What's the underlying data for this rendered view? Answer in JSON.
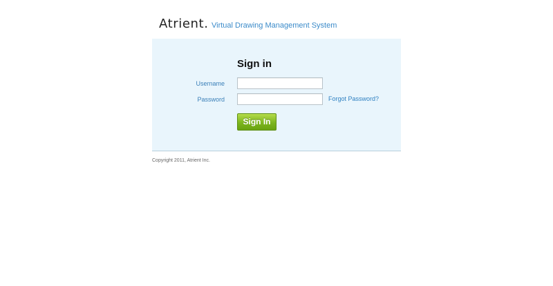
{
  "header": {
    "logo_text": "Atrient.",
    "tagline": "Virtual Drawing Management System"
  },
  "signin": {
    "heading": "Sign in",
    "username_label": "Username",
    "username_value": "",
    "password_label": "Password",
    "password_value": "",
    "forgot_link": "Forgot Password?",
    "button_label": "Sign In"
  },
  "footer": {
    "copyright": "Copyright 2011, Atrient Inc."
  },
  "colors": {
    "panel_background": "#e9f5fc",
    "accent_blue": "#3a8ac9",
    "button_green": "#7cb51e"
  }
}
